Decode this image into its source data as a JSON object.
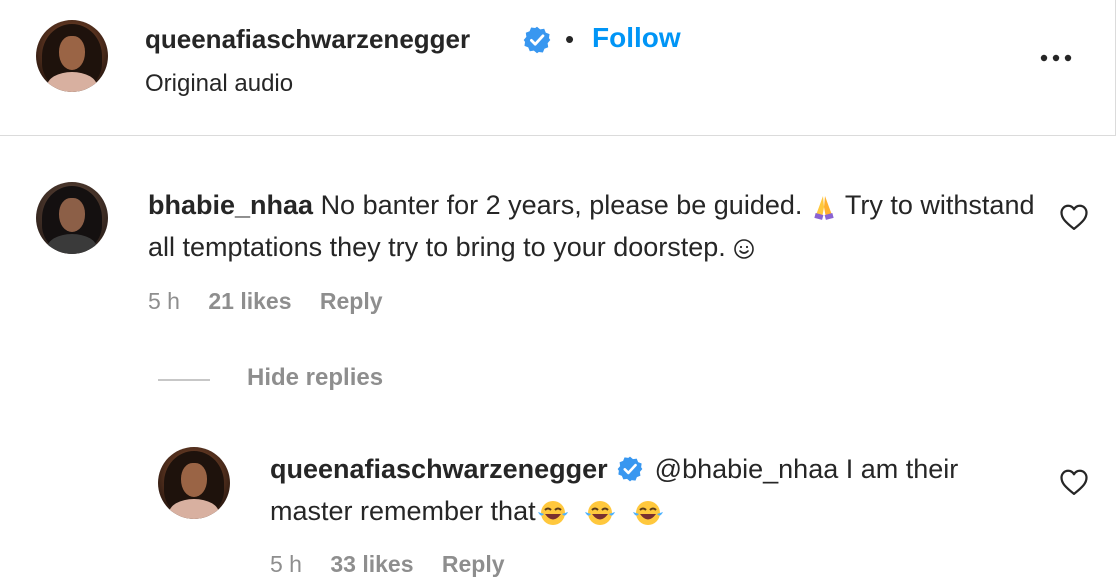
{
  "post_header": {
    "username": "queenafiaschwarzenegger",
    "separator": "•",
    "follow_label": "Follow",
    "audio": "Original audio",
    "more_icon": "more-horizontal-icon"
  },
  "comment": {
    "username": "bhabie_nhaa",
    "text_part1": "No banter for 2 years, please be guided.",
    "text_part2": "Try to withstand all temptations they try to bring to your doorstep.",
    "time": "5 h",
    "likes": "21 likes",
    "reply_label": "Reply"
  },
  "hide_replies_label": "Hide replies",
  "reply": {
    "username": "queenafiaschwarzenegger",
    "mention": "@bhabie_nhaa",
    "text": "I am their master remember that",
    "time": "5 h",
    "likes": "33 likes",
    "reply_label": "Reply"
  },
  "colors": {
    "link_blue": "#0095f6",
    "verified_blue": "#3897f0",
    "muted": "#8e8e8e",
    "text": "#262626"
  }
}
